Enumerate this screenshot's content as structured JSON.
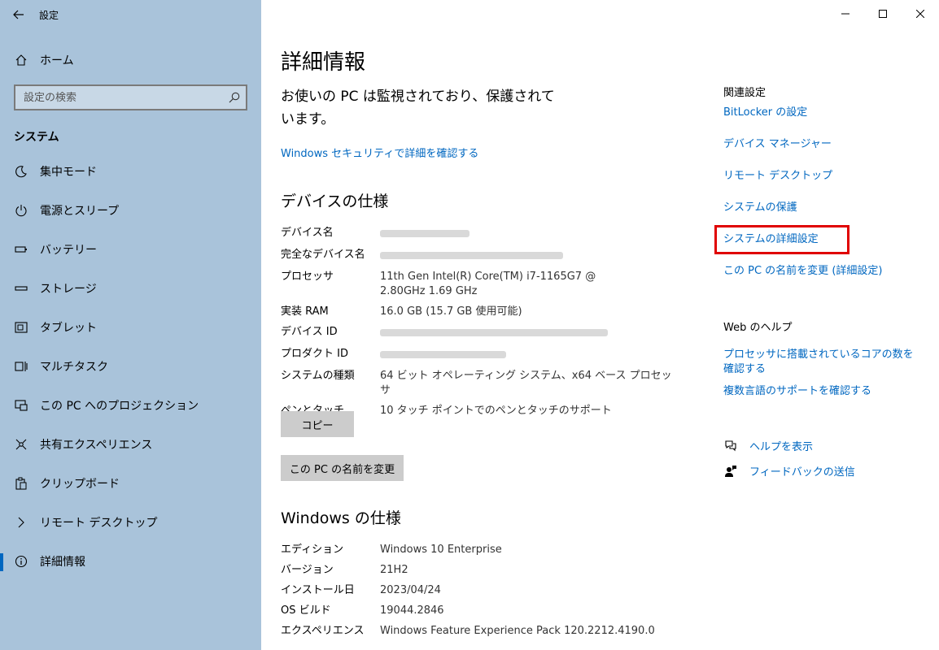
{
  "window": {
    "app_title": "設定",
    "controls": {
      "minimize": "—",
      "maximize": "☐",
      "close": "✕"
    }
  },
  "sidebar": {
    "home_label": "ホーム",
    "search_placeholder": "設定の検索",
    "section_header": "システム",
    "items": [
      {
        "label": "集中モード",
        "icon": "moon-icon"
      },
      {
        "label": "電源とスリープ",
        "icon": "power-icon"
      },
      {
        "label": "バッテリー",
        "icon": "battery-icon"
      },
      {
        "label": "ストレージ",
        "icon": "storage-icon"
      },
      {
        "label": "タブレット",
        "icon": "tablet-icon"
      },
      {
        "label": "マルチタスク",
        "icon": "multitask-icon"
      },
      {
        "label": "この PC へのプロジェクション",
        "icon": "projection-icon"
      },
      {
        "label": "共有エクスペリエンス",
        "icon": "shared-experience-icon"
      },
      {
        "label": "クリップボード",
        "icon": "clipboard-icon"
      },
      {
        "label": "リモート デスクトップ",
        "icon": "remote-desktop-icon"
      },
      {
        "label": "詳細情報",
        "icon": "info-icon",
        "selected": true
      }
    ]
  },
  "main": {
    "title": "詳細情報",
    "status_message": "お使いの PC は監視されており、保護されています。",
    "security_link": "Windows セキュリティで詳細を確認する",
    "device_specs": {
      "heading": "デバイスの仕様",
      "rows": [
        {
          "key": "デバイス名",
          "value": "",
          "blurred": true
        },
        {
          "key": "完全なデバイス名",
          "value": "",
          "blurred": true
        },
        {
          "key": "プロセッサ",
          "value": "11th Gen Intel(R) Core(TM) i7-1165G7 @ 2.80GHz 1.69 GHz"
        },
        {
          "key": "実装 RAM",
          "value": "16.0 GB (15.7 GB 使用可能)"
        },
        {
          "key": "デバイス ID",
          "value": "",
          "blurred": true
        },
        {
          "key": "プロダクト ID",
          "value": "",
          "blurred": true
        },
        {
          "key": "システムの種類",
          "value": "64 ビット オペレーティング システム、x64 ベース プロセッサ"
        },
        {
          "key": "ペンとタッチ",
          "value": "10 タッチ ポイントでのペンとタッチのサポート"
        }
      ],
      "copy_button": "コピー",
      "rename_button": "この PC の名前を変更"
    },
    "windows_specs": {
      "heading": "Windows の仕様",
      "rows": [
        {
          "key": "エディション",
          "value": "Windows 10 Enterprise"
        },
        {
          "key": "バージョン",
          "value": "21H2"
        },
        {
          "key": "インストール日",
          "value": "2023/04/24"
        },
        {
          "key": "OS ビルド",
          "value": "19044.2846"
        },
        {
          "key": "エクスペリエンス",
          "value": "Windows Feature Experience Pack 120.2212.4190.0"
        }
      ]
    }
  },
  "related": {
    "heading": "関連設定",
    "links": [
      "BitLocker の設定",
      "デバイス マネージャー",
      "リモート デスクトップ",
      "システムの保護",
      "システムの詳細設定",
      "この PC の名前を変更 (詳細設定)"
    ],
    "web_help_heading": "Web のヘルプ",
    "web_help_links": [
      "プロセッサに搭載されているコアの数を確認する",
      "複数言語のサポートを確認する"
    ],
    "help_label": "ヘルプを表示",
    "feedback_label": "フィードバックの送信"
  },
  "colors": {
    "sidebar_bg": "#a9c3da",
    "link": "#0067c0",
    "highlight": "#e00000",
    "button_bg": "#cccccc"
  }
}
